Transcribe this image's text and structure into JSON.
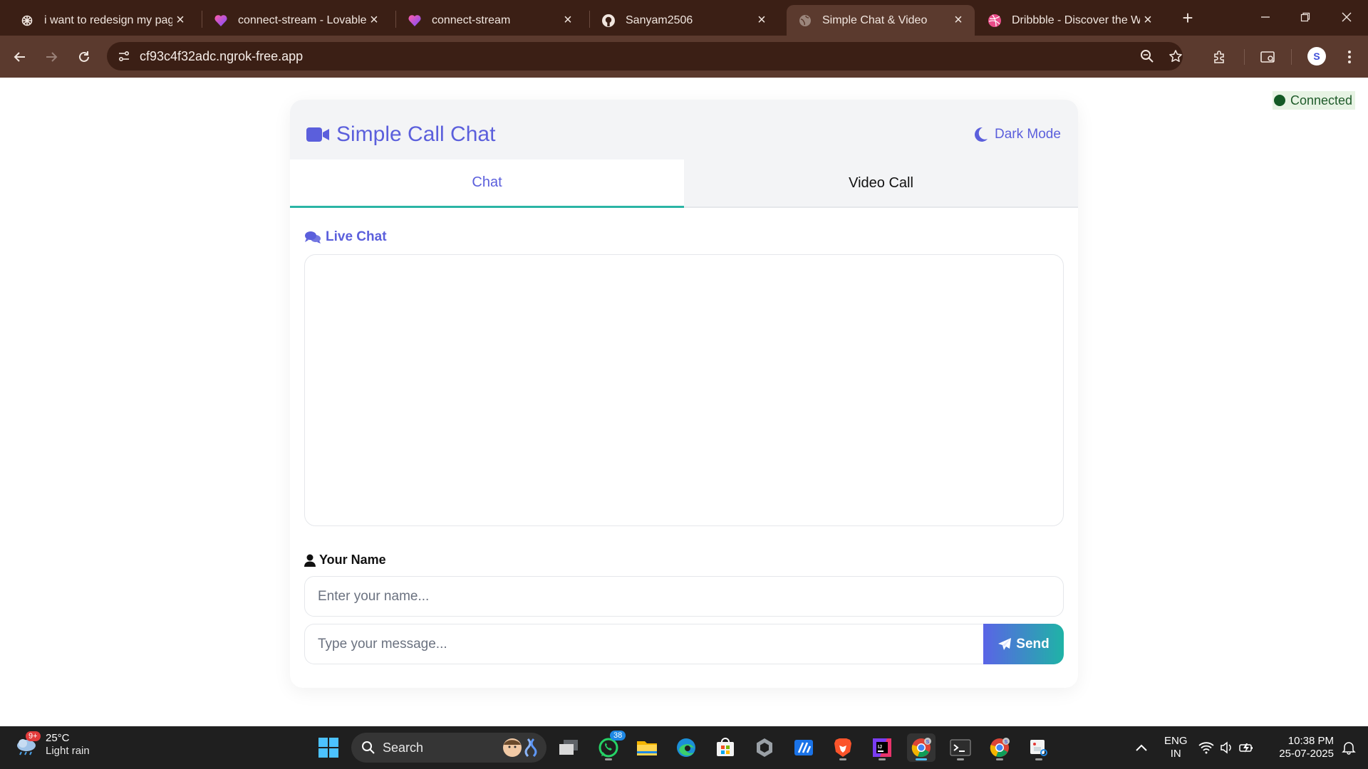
{
  "browser": {
    "tabs": [
      {
        "title": "i want to redesign my page",
        "icon": "openai-icon",
        "active": false
      },
      {
        "title": "connect-stream - Lovable",
        "icon": "lovable-heart-icon",
        "active": false
      },
      {
        "title": "connect-stream",
        "icon": "lovable-heart-icon",
        "active": false
      },
      {
        "title": "Sanyam2506",
        "icon": "github-icon",
        "active": false
      },
      {
        "title": "Simple Chat & Video",
        "icon": "globe-icon",
        "active": true
      },
      {
        "title": "Dribbble - Discover the World's Top Designers",
        "icon": "dribbble-icon",
        "active": false
      }
    ],
    "url": "cf93c4f32adc.ngrok-free.app",
    "profile_initial": "S",
    "colors": {
      "frame": "#3b1f15",
      "toolbar": "#5b3a2e"
    }
  },
  "page": {
    "status": "Connected",
    "app_title": "Simple Call Chat",
    "dark_mode_label": "Dark Mode",
    "tabs": {
      "chat": "Chat",
      "video": "Video Call"
    },
    "section_title": "Live Chat",
    "name_label": "Your Name",
    "name_placeholder": "Enter your name...",
    "message_placeholder": "Type your message...",
    "send_label": "Send",
    "colors": {
      "accent": "#5b5fdc",
      "teal": "#2bb5a5",
      "status_green": "#145a26"
    }
  },
  "taskbar": {
    "weather": {
      "temp": "25°C",
      "condition": "Light rain",
      "badge": "9+"
    },
    "search_label": "Search",
    "whatsapp_badge": "38",
    "language": {
      "line1": "ENG",
      "line2": "IN"
    },
    "time": "10:38 PM",
    "date": "25-07-2025"
  }
}
